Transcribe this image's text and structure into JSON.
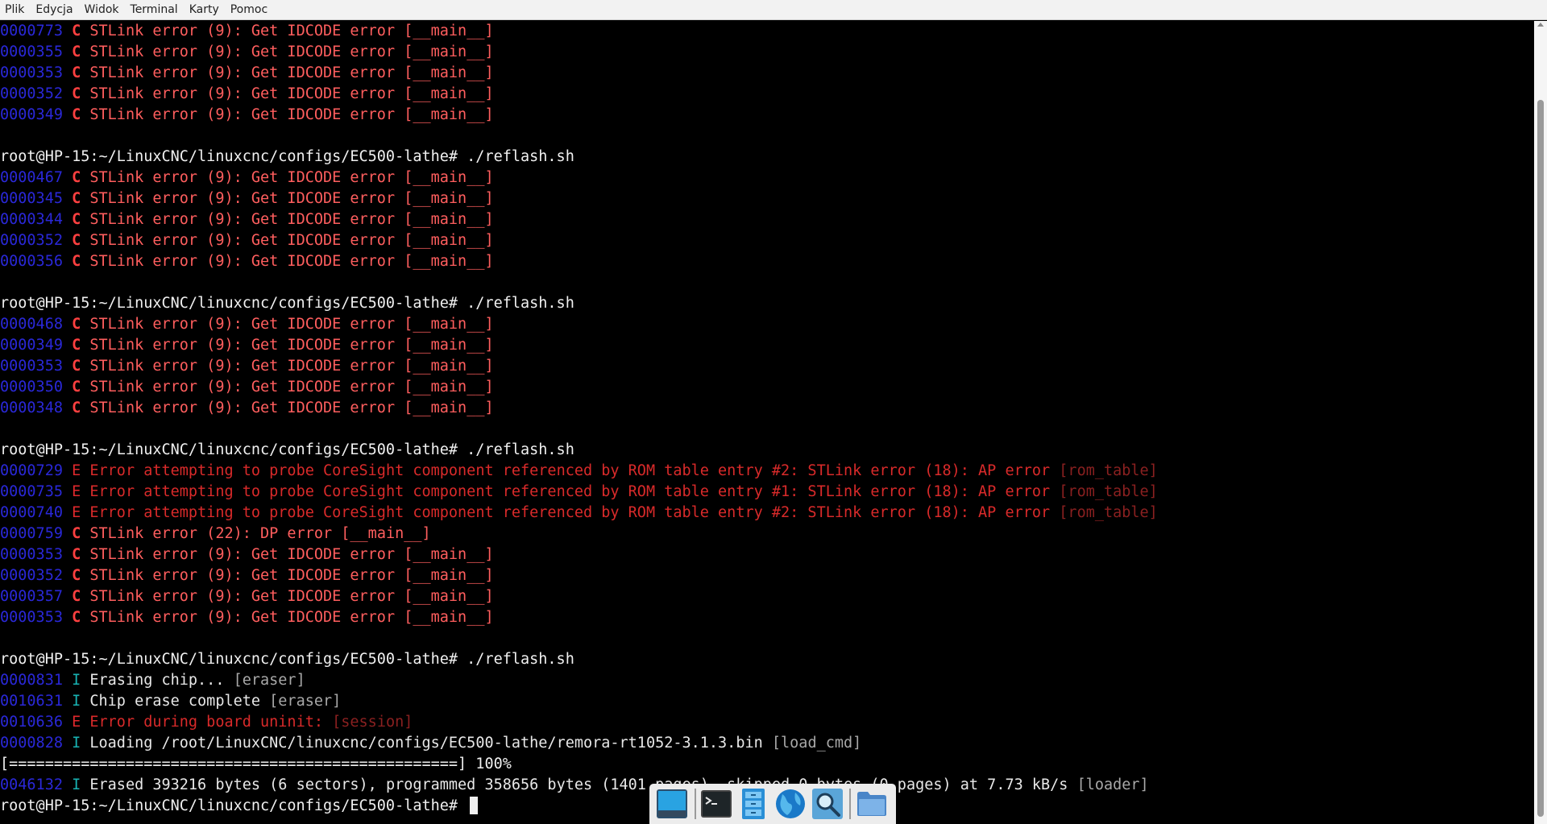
{
  "menu": [
    "Plik",
    "Edycja",
    "Widok",
    "Terminal",
    "Karty",
    "Pomoc"
  ],
  "terminal": {
    "lines": [
      {
        "type": "log",
        "ts": "0000773",
        "lvl": "C",
        "msg": "STLink error (9): Get IDCODE error",
        "tag": "[__main__]"
      },
      {
        "type": "log",
        "ts": "0000355",
        "lvl": "C",
        "msg": "STLink error (9): Get IDCODE error",
        "tag": "[__main__]"
      },
      {
        "type": "log",
        "ts": "0000353",
        "lvl": "C",
        "msg": "STLink error (9): Get IDCODE error",
        "tag": "[__main__]"
      },
      {
        "type": "log",
        "ts": "0000352",
        "lvl": "C",
        "msg": "STLink error (9): Get IDCODE error",
        "tag": "[__main__]"
      },
      {
        "type": "log",
        "ts": "0000349",
        "lvl": "C",
        "msg": "STLink error (9): Get IDCODE error",
        "tag": "[__main__]"
      },
      {
        "type": "blank"
      },
      {
        "type": "prompt",
        "text": "root@HP-15:~/LinuxCNC/linuxcnc/configs/EC500-lathe# ./reflash.sh"
      },
      {
        "type": "log",
        "ts": "0000467",
        "lvl": "C",
        "msg": "STLink error (9): Get IDCODE error",
        "tag": "[__main__]"
      },
      {
        "type": "log",
        "ts": "0000345",
        "lvl": "C",
        "msg": "STLink error (9): Get IDCODE error",
        "tag": "[__main__]"
      },
      {
        "type": "log",
        "ts": "0000344",
        "lvl": "C",
        "msg": "STLink error (9): Get IDCODE error",
        "tag": "[__main__]"
      },
      {
        "type": "log",
        "ts": "0000352",
        "lvl": "C",
        "msg": "STLink error (9): Get IDCODE error",
        "tag": "[__main__]"
      },
      {
        "type": "log",
        "ts": "0000356",
        "lvl": "C",
        "msg": "STLink error (9): Get IDCODE error",
        "tag": "[__main__]"
      },
      {
        "type": "blank"
      },
      {
        "type": "prompt",
        "text": "root@HP-15:~/LinuxCNC/linuxcnc/configs/EC500-lathe# ./reflash.sh"
      },
      {
        "type": "log",
        "ts": "0000468",
        "lvl": "C",
        "msg": "STLink error (9): Get IDCODE error",
        "tag": "[__main__]"
      },
      {
        "type": "log",
        "ts": "0000349",
        "lvl": "C",
        "msg": "STLink error (9): Get IDCODE error",
        "tag": "[__main__]"
      },
      {
        "type": "log",
        "ts": "0000353",
        "lvl": "C",
        "msg": "STLink error (9): Get IDCODE error",
        "tag": "[__main__]"
      },
      {
        "type": "log",
        "ts": "0000350",
        "lvl": "C",
        "msg": "STLink error (9): Get IDCODE error",
        "tag": "[__main__]"
      },
      {
        "type": "log",
        "ts": "0000348",
        "lvl": "C",
        "msg": "STLink error (9): Get IDCODE error",
        "tag": "[__main__]"
      },
      {
        "type": "blank"
      },
      {
        "type": "prompt",
        "text": "root@HP-15:~/LinuxCNC/linuxcnc/configs/EC500-lathe# ./reflash.sh"
      },
      {
        "type": "log",
        "ts": "0000729",
        "lvl": "E",
        "msg": "Error attempting to probe CoreSight component referenced by ROM table entry #2: STLink error (18): AP error",
        "tag": "[rom_table]"
      },
      {
        "type": "log",
        "ts": "0000735",
        "lvl": "E",
        "msg": "Error attempting to probe CoreSight component referenced by ROM table entry #1: STLink error (18): AP error",
        "tag": "[rom_table]"
      },
      {
        "type": "log",
        "ts": "0000740",
        "lvl": "E",
        "msg": "Error attempting to probe CoreSight component referenced by ROM table entry #2: STLink error (18): AP error",
        "tag": "[rom_table]"
      },
      {
        "type": "log",
        "ts": "0000759",
        "lvl": "C",
        "msg": "STLink error (22): DP error",
        "tag": "[__main__]"
      },
      {
        "type": "log",
        "ts": "0000353",
        "lvl": "C",
        "msg": "STLink error (9): Get IDCODE error",
        "tag": "[__main__]"
      },
      {
        "type": "log",
        "ts": "0000352",
        "lvl": "C",
        "msg": "STLink error (9): Get IDCODE error",
        "tag": "[__main__]"
      },
      {
        "type": "log",
        "ts": "0000357",
        "lvl": "C",
        "msg": "STLink error (9): Get IDCODE error",
        "tag": "[__main__]"
      },
      {
        "type": "log",
        "ts": "0000353",
        "lvl": "C",
        "msg": "STLink error (9): Get IDCODE error",
        "tag": "[__main__]"
      },
      {
        "type": "blank"
      },
      {
        "type": "prompt",
        "text": "root@HP-15:~/LinuxCNC/linuxcnc/configs/EC500-lathe# ./reflash.sh"
      },
      {
        "type": "log",
        "ts": "0000831",
        "lvl": "I",
        "msg": "Erasing chip...",
        "tag": "[eraser]"
      },
      {
        "type": "log",
        "ts": "0010631",
        "lvl": "I",
        "msg": "Chip erase complete",
        "tag": "[eraser]"
      },
      {
        "type": "log",
        "ts": "0010636",
        "lvl": "E",
        "msg": "Error during board uninit:",
        "tag": "[session]"
      },
      {
        "type": "log",
        "ts": "0000828",
        "lvl": "I",
        "msg": "Loading /root/LinuxCNC/linuxcnc/configs/EC500-lathe/remora-rt1052-3.1.3.bin",
        "tag": "[load_cmd]"
      },
      {
        "type": "plain",
        "text": "[==================================================] 100%"
      },
      {
        "type": "log",
        "ts": "0046132",
        "lvl": "I",
        "msg": "Erased 393216 bytes (6 sectors), programmed 358656 bytes (1401 pages), skipped 0 bytes (0 pages) at 7.73 kB/s",
        "tag": "[loader]"
      },
      {
        "type": "prompt_cursor",
        "text": "root@HP-15:~/LinuxCNC/linuxcnc/configs/EC500-lathe# "
      }
    ]
  },
  "dock": {
    "items": [
      "show-desktop-icon",
      "terminal-icon",
      "file-manager-icon",
      "web-browser-icon",
      "app-finder-icon",
      "folder-icon"
    ]
  }
}
